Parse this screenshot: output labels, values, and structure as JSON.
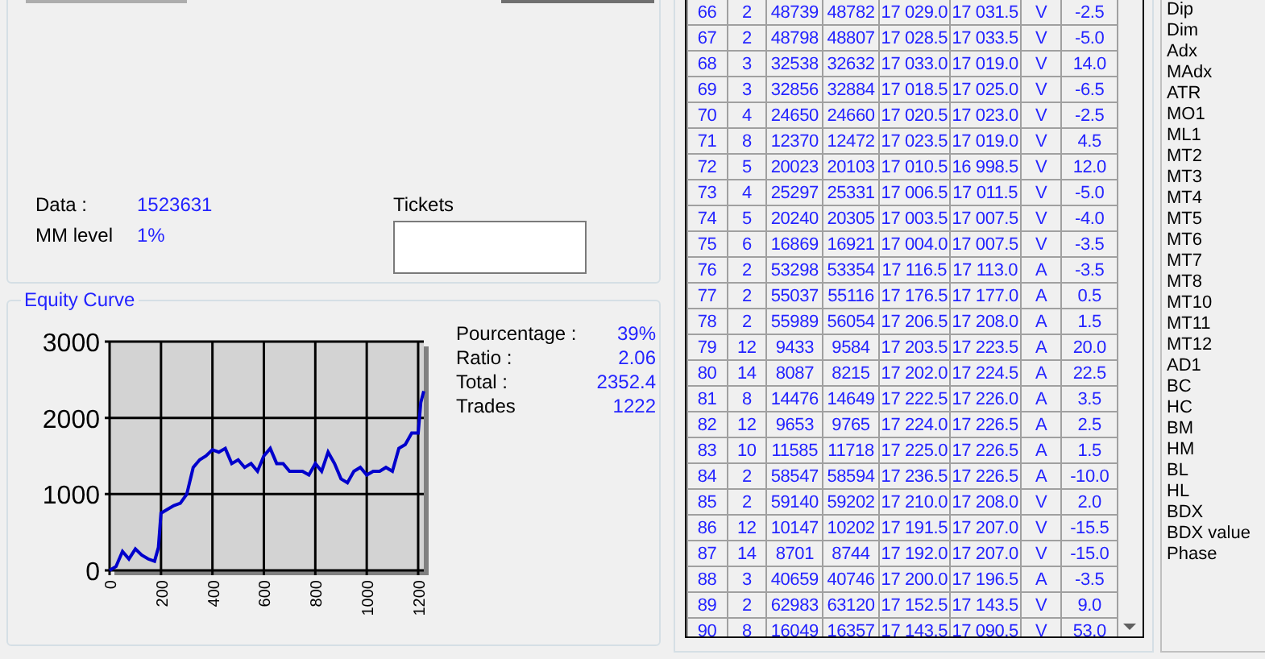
{
  "summary": {
    "fields": [
      {
        "label": "Data :",
        "value": "1523631"
      },
      {
        "label": "MM level",
        "value": "1%"
      }
    ],
    "tickets": {
      "label": "Tickets"
    }
  },
  "equity_curve": {
    "title": "Equity Curve",
    "chart_data": {
      "type": "line",
      "x": [
        0,
        25,
        50,
        75,
        100,
        125,
        150,
        175,
        190,
        200,
        225,
        250,
        275,
        300,
        325,
        350,
        375,
        400,
        425,
        450,
        475,
        500,
        525,
        550,
        575,
        600,
        625,
        650,
        675,
        700,
        725,
        750,
        775,
        800,
        825,
        850,
        875,
        900,
        925,
        950,
        975,
        1000,
        1025,
        1050,
        1075,
        1100,
        1125,
        1150,
        1175,
        1200,
        1210,
        1222
      ],
      "grid": true,
      "series": [
        {
          "color": "#0000cc",
          "values": [
            0,
            50,
            250,
            150,
            280,
            200,
            150,
            120,
            300,
            750,
            800,
            850,
            880,
            1000,
            1350,
            1450,
            1500,
            1580,
            1550,
            1600,
            1400,
            1450,
            1350,
            1400,
            1300,
            1500,
            1600,
            1400,
            1400,
            1300,
            1300,
            1300,
            1250,
            1400,
            1300,
            1550,
            1400,
            1200,
            1150,
            1300,
            1350,
            1250,
            1300,
            1300,
            1350,
            1300,
            1600,
            1650,
            1800,
            1800,
            2200,
            2350
          ]
        }
      ],
      "xlim": [
        0,
        1222
      ],
      "ylim": [
        0,
        3000
      ],
      "xticks": [
        0,
        200,
        400,
        600,
        800,
        1000,
        1200
      ],
      "yticks": [
        0,
        1000,
        2000,
        3000
      ]
    },
    "stats": [
      {
        "label": "Pourcentage :",
        "value": "39%"
      },
      {
        "label": "Ratio :",
        "value": "2.06"
      },
      {
        "label": "Total :",
        "value": "2352.4"
      },
      {
        "label": "Trades",
        "value": "1222"
      }
    ]
  },
  "trades_table": {
    "rows": [
      [
        "66",
        "2",
        "48739",
        "48782",
        "17 029.0",
        "17 031.5",
        "V",
        "-2.5"
      ],
      [
        "67",
        "2",
        "48798",
        "48807",
        "17 028.5",
        "17 033.5",
        "V",
        "-5.0"
      ],
      [
        "68",
        "3",
        "32538",
        "32632",
        "17 033.0",
        "17 019.0",
        "V",
        "14.0"
      ],
      [
        "69",
        "3",
        "32856",
        "32884",
        "17 018.5",
        "17 025.0",
        "V",
        "-6.5"
      ],
      [
        "70",
        "4",
        "24650",
        "24660",
        "17 020.5",
        "17 023.0",
        "V",
        "-2.5"
      ],
      [
        "71",
        "8",
        "12370",
        "12472",
        "17 023.5",
        "17 019.0",
        "V",
        "4.5"
      ],
      [
        "72",
        "5",
        "20023",
        "20103",
        "17 010.5",
        "16 998.5",
        "V",
        "12.0"
      ],
      [
        "73",
        "4",
        "25297",
        "25331",
        "17 006.5",
        "17 011.5",
        "V",
        "-5.0"
      ],
      [
        "74",
        "5",
        "20240",
        "20305",
        "17 003.5",
        "17 007.5",
        "V",
        "-4.0"
      ],
      [
        "75",
        "6",
        "16869",
        "16921",
        "17 004.0",
        "17 007.5",
        "V",
        "-3.5"
      ],
      [
        "76",
        "2",
        "53298",
        "53354",
        "17 116.5",
        "17 113.0",
        "A",
        "-3.5"
      ],
      [
        "77",
        "2",
        "55037",
        "55116",
        "17 176.5",
        "17 177.0",
        "A",
        "0.5"
      ],
      [
        "78",
        "2",
        "55989",
        "56054",
        "17 206.5",
        "17 208.0",
        "A",
        "1.5"
      ],
      [
        "79",
        "12",
        "9433",
        "9584",
        "17 203.5",
        "17 223.5",
        "A",
        "20.0"
      ],
      [
        "80",
        "14",
        "8087",
        "8215",
        "17 202.0",
        "17 224.5",
        "A",
        "22.5"
      ],
      [
        "81",
        "8",
        "14476",
        "14649",
        "17 222.5",
        "17 226.0",
        "A",
        "3.5"
      ],
      [
        "82",
        "12",
        "9653",
        "9765",
        "17 224.0",
        "17 226.5",
        "A",
        "2.5"
      ],
      [
        "83",
        "10",
        "11585",
        "11718",
        "17 225.0",
        "17 226.5",
        "A",
        "1.5"
      ],
      [
        "84",
        "2",
        "58547",
        "58594",
        "17 236.5",
        "17 226.5",
        "A",
        "-10.0"
      ],
      [
        "85",
        "2",
        "59140",
        "59202",
        "17 210.0",
        "17 208.0",
        "V",
        "2.0"
      ],
      [
        "86",
        "12",
        "10147",
        "10202",
        "17 191.5",
        "17 207.0",
        "V",
        "-15.5"
      ],
      [
        "87",
        "14",
        "8701",
        "8744",
        "17 192.0",
        "17 207.0",
        "V",
        "-15.0"
      ],
      [
        "88",
        "3",
        "40659",
        "40746",
        "17 200.0",
        "17 196.5",
        "A",
        "-3.5"
      ],
      [
        "89",
        "2",
        "62983",
        "63120",
        "17 152.5",
        "17 143.5",
        "V",
        "9.0"
      ],
      [
        "90",
        "8",
        "16049",
        "16357",
        "17 143.5",
        "17 090.5",
        "V",
        "53.0"
      ]
    ]
  },
  "indicators": {
    "items": [
      "Dip",
      "Dim",
      "Adx",
      "MAdx",
      "ATR",
      "MO1",
      "ML1",
      "MT2",
      "MT3",
      "MT4",
      "MT5",
      "MT6",
      "MT7",
      "MT8",
      "MT10",
      "MT11",
      "MT12",
      "AD1",
      "BC",
      "HC",
      "BM",
      "HM",
      "BL",
      "HL",
      "BDX",
      "BDX value",
      "Phase"
    ]
  }
}
